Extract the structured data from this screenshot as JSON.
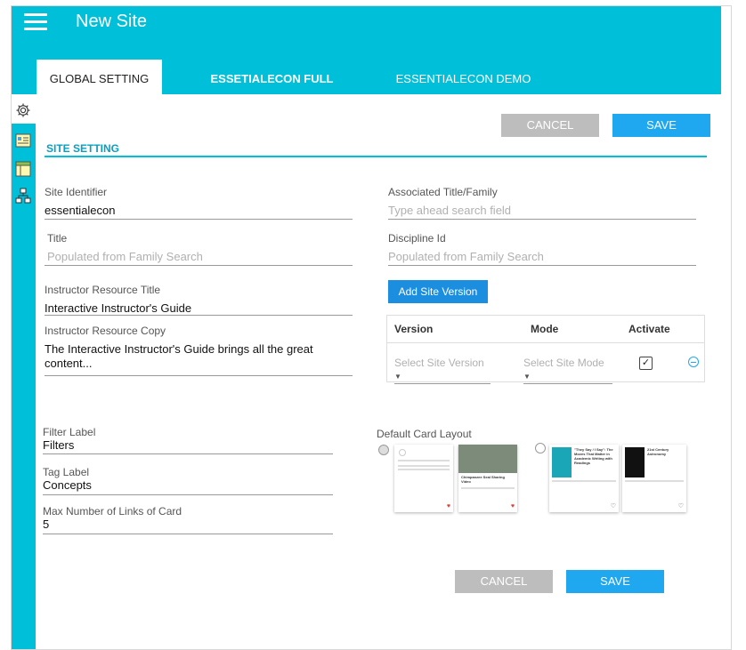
{
  "header": {
    "title": "New Site"
  },
  "tabs": [
    {
      "label": "GLOBAL SETTING"
    },
    {
      "label": "ESSETIALECON FULL"
    },
    {
      "label": "ESSENTIALECON DEMO"
    }
  ],
  "actions": {
    "cancel_label": "CANCEL",
    "save_label": "SAVE"
  },
  "section": {
    "title": "SITE SETTING"
  },
  "fields": {
    "site_identifier": {
      "label": "Site Identifier",
      "value": "essentialecon"
    },
    "associated_title": {
      "label": "Associated Title/Family",
      "placeholder": "Type ahead search field"
    },
    "title": {
      "label": "Title",
      "placeholder": "Populated from Family Search"
    },
    "discipline_id": {
      "label": "Discipline Id",
      "placeholder": "Populated from Family Search"
    },
    "instructor_resource_title": {
      "label": "Instructor Resource Title",
      "value": "Interactive Instructor's Guide"
    },
    "instructor_resource_copy": {
      "label": "Instructor Resource Copy",
      "value": "The Interactive Instructor's Guide brings all the great content..."
    },
    "filter_label": {
      "label": "Filter Label",
      "value": "Filters"
    },
    "tag_label": {
      "label": "Tag Label",
      "value": "Concepts"
    },
    "max_links": {
      "label": "Max Number of Links of Card",
      "value": "5"
    }
  },
  "version_table": {
    "add_button": "Add Site Version",
    "headers": {
      "version": "Version",
      "mode": "Mode",
      "activate": "Activate"
    },
    "row": {
      "version_placeholder": "Select Site Version",
      "mode_placeholder": "Select Site Mode",
      "activated": true
    }
  },
  "card_layout": {
    "label": "Default Card Layout",
    "options": [
      {
        "selected": true,
        "cards": [
          "Chimpanzee Seal Sharing Video"
        ]
      },
      {
        "selected": false,
        "cards": [
          "\"They Say / I Say\": The Moves That Matter in Academic Writing with Readings",
          "21st Century Astronomy"
        ]
      }
    ]
  },
  "colors": {
    "primary": "#00bfd8",
    "save_button": "#1fa8f0",
    "cancel_button": "#bdbdbd",
    "add_button": "#1c8ee0"
  }
}
